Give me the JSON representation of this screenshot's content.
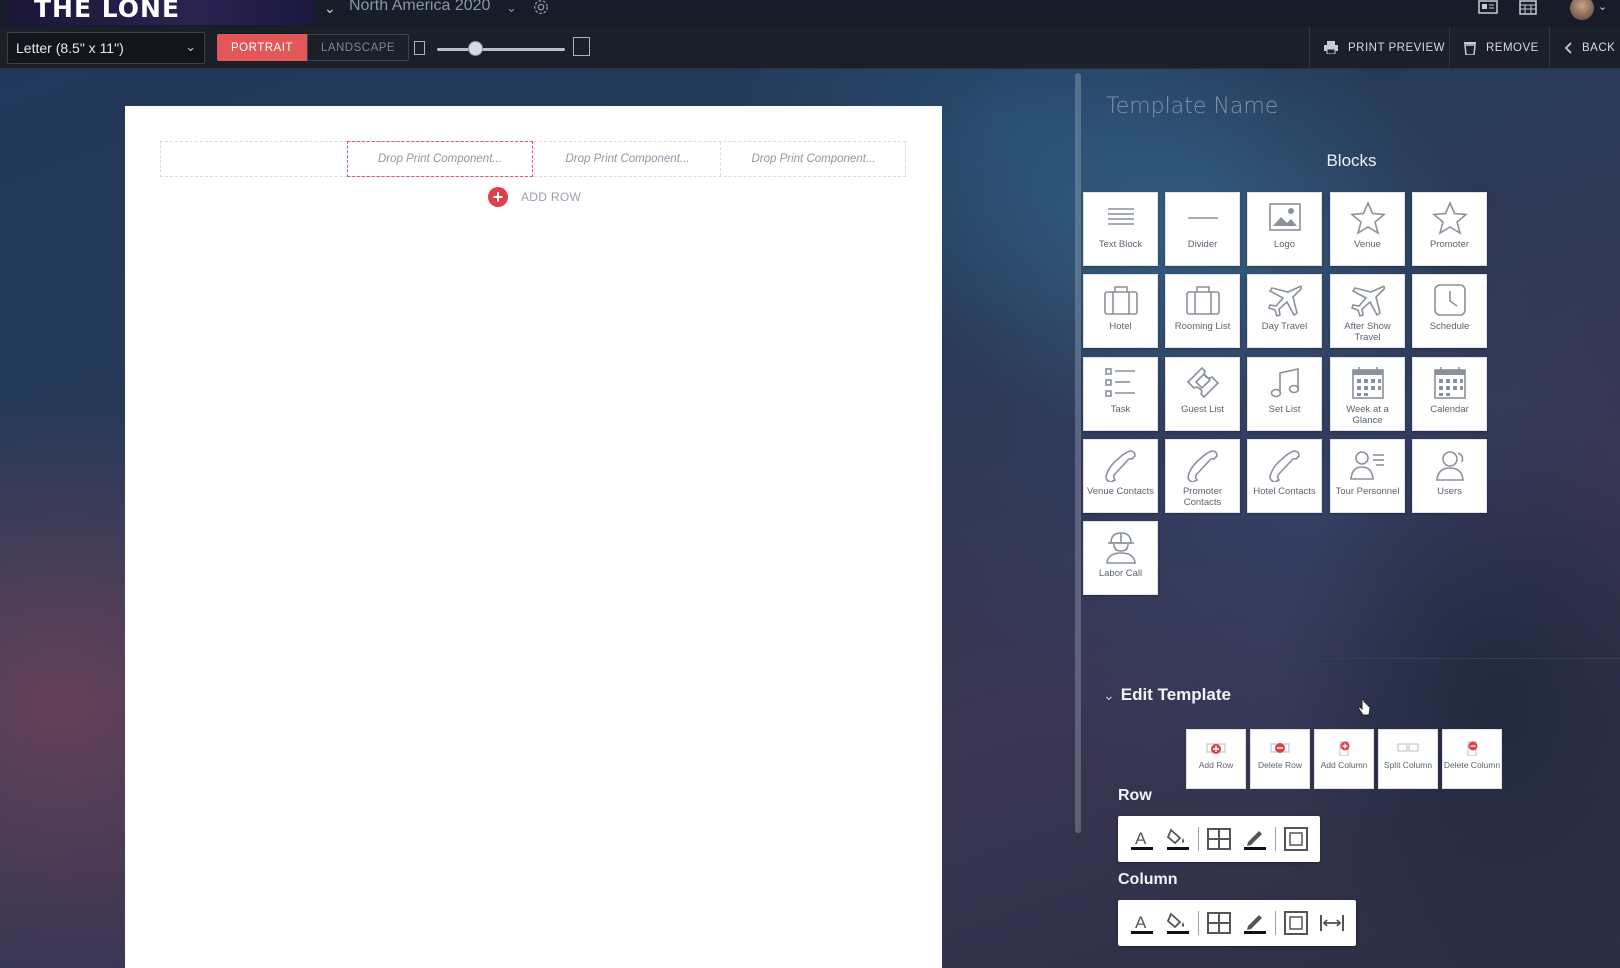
{
  "header": {
    "brand": "THE LONE RANGERS",
    "tour_name": "North America 2020"
  },
  "toolbar": {
    "paper_size": "Letter (8.5\" x 11\")",
    "orientation_selected": "PORTRAIT",
    "orientation_other": "LANDSCAPE",
    "zoom_level": 0.3,
    "print_preview": "PRINT PREVIEW",
    "remove": "REMOVE",
    "back": "BACK"
  },
  "canvas": {
    "drop_placeholder": "Drop Print Component...",
    "add_row": "ADD ROW"
  },
  "panel": {
    "template_name_placeholder": "Template Name",
    "blocks_title": "Blocks",
    "blocks": [
      {
        "label": "Text Block",
        "icon": "text-block-icon"
      },
      {
        "label": "Divider",
        "icon": "divider-icon"
      },
      {
        "label": "Logo",
        "icon": "image-icon"
      },
      {
        "label": "Venue",
        "icon": "star-icon"
      },
      {
        "label": "Promoter",
        "icon": "star-icon"
      },
      {
        "label": "Hotel",
        "icon": "suitcase-icon"
      },
      {
        "label": "Rooming List",
        "icon": "suitcase-icon"
      },
      {
        "label": "Day Travel",
        "icon": "airplane-icon"
      },
      {
        "label": "After Show Travel",
        "icon": "airplane-icon"
      },
      {
        "label": "Schedule",
        "icon": "clock-icon"
      },
      {
        "label": "Task",
        "icon": "checklist-icon"
      },
      {
        "label": "Guest List",
        "icon": "ticket-icon"
      },
      {
        "label": "Set List",
        "icon": "music-note-icon"
      },
      {
        "label": "Week at a Glance",
        "icon": "calendar-icon"
      },
      {
        "label": "Calendar",
        "icon": "calendar-icon"
      },
      {
        "label": "Venue Contacts",
        "icon": "phone-icon"
      },
      {
        "label": "Promoter Contacts",
        "icon": "phone-icon"
      },
      {
        "label": "Hotel Contacts",
        "icon": "phone-icon"
      },
      {
        "label": "Tour Personnel",
        "icon": "personnel-icon"
      },
      {
        "label": "Users",
        "icon": "users-icon"
      },
      {
        "label": "Labor Call",
        "icon": "hardhat-worker-icon"
      }
    ],
    "edit_template_title": "Edit Template",
    "edit_buttons": [
      "Add Row",
      "Delete Row",
      "Add Column",
      "Split Column",
      "Delete Column"
    ],
    "row_label": "Row",
    "column_label": "Column"
  },
  "colors": {
    "accent": "#e25757",
    "add_red": "#e03e4a",
    "panel_title": "#7f92ad"
  }
}
